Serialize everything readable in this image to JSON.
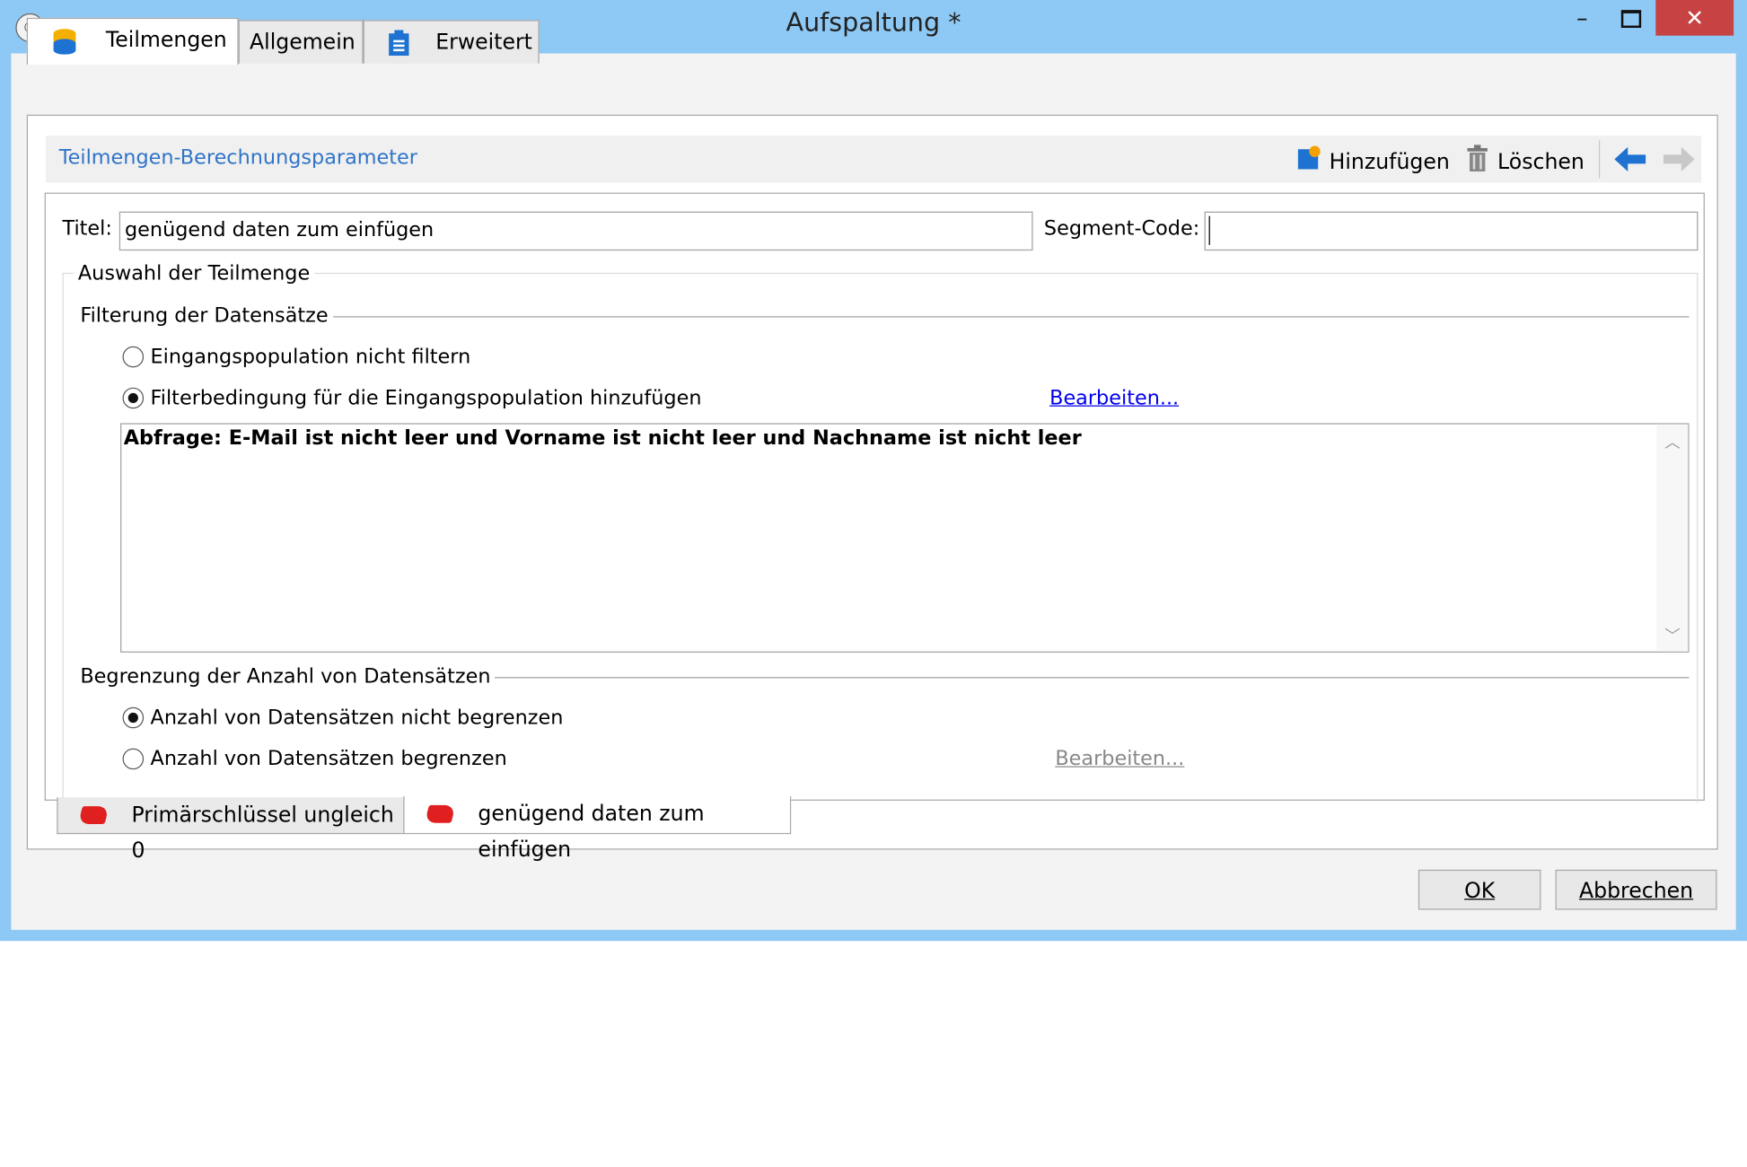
{
  "window": {
    "title": "Aufspaltung *"
  },
  "tabs": [
    {
      "label": "Teilmengen",
      "icon": "database-icon",
      "active": true
    },
    {
      "label": "Allgemein",
      "active": false
    },
    {
      "label": "Erweitert",
      "icon": "clipboard-icon",
      "active": false
    }
  ],
  "toolbar": {
    "title": "Teilmengen-Berechnungsparameter",
    "add_label": "Hinzufügen",
    "delete_label": "Löschen"
  },
  "form": {
    "title_label": "Titel:",
    "title_value": "genügend daten zum einfügen",
    "segment_label": "Segment-Code:",
    "segment_value": ""
  },
  "selection": {
    "group_label": "Auswahl der Teilmenge",
    "filter_section": "Filterung der Datensätze",
    "filter_option_none": "Eingangspopulation nicht filtern",
    "filter_option_add": "Filterbedingung für die Eingangspopulation hinzufügen",
    "filter_selected": "add",
    "edit_link": "Bearbeiten...",
    "query_text": "Abfrage: E-Mail ist nicht leer und Vorname ist nicht leer und Nachname ist nicht leer",
    "limit_section": "Begrenzung der Anzahl von Datensätzen",
    "limit_option_none": "Anzahl von Datensätzen nicht begrenzen",
    "limit_option_limit": "Anzahl von Datensätzen begrenzen",
    "limit_selected": "none",
    "limit_edit_link": "Bearbeiten..."
  },
  "subset_tabs": [
    {
      "label": "Primärschlüssel ungleich 0",
      "active": false
    },
    {
      "label": "genügend daten zum einfügen",
      "active": true
    }
  ],
  "buttons": {
    "ok": "OK",
    "cancel": "Abbrechen"
  },
  "colors": {
    "window_frame": "#8ec9f5",
    "close_button": "#c74343",
    "link": "#0000ee",
    "toolbar_title": "#2f74c8",
    "subset_icon": "#e02020"
  }
}
